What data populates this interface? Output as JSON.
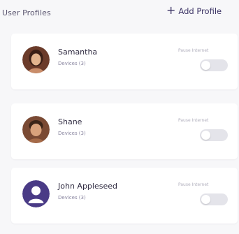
{
  "header": {
    "title": "User Profiles",
    "add_label": "Add Profile"
  },
  "profiles": [
    {
      "name": "Samantha",
      "devices": "Devices (3)",
      "pause_label": "Pause Internet",
      "paused": false,
      "avatar": "photo"
    },
    {
      "name": "Shane",
      "devices": "Devices (3)",
      "pause_label": "Pause Internet",
      "paused": false,
      "avatar": "photo"
    },
    {
      "name": "John Appleseed",
      "devices": "Devices (3)",
      "pause_label": "Pause Internet",
      "paused": false,
      "avatar": "placeholder-user-icon"
    }
  ],
  "colors": {
    "accent": "#3d3566",
    "placeholder_avatar": "#4a3b86",
    "toggle_off": "#e4e4ea"
  }
}
